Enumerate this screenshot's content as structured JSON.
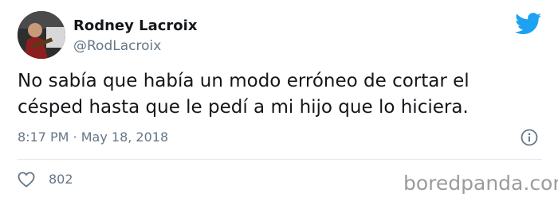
{
  "author": {
    "name": "Rodney Lacroix",
    "handle": "@RodLacroix"
  },
  "tweet": {
    "text_line1": "No sabía que había un modo erróneo de cortar el",
    "text_line2": "césped hasta que le pedí a mi hijo que lo hiciera.",
    "timestamp": "8:17 PM · May 18, 2018",
    "likes": "802"
  },
  "watermark": "boredpanda.com",
  "colors": {
    "brand": "#1da1f2",
    "muted": "#657786",
    "text": "#14171a"
  }
}
